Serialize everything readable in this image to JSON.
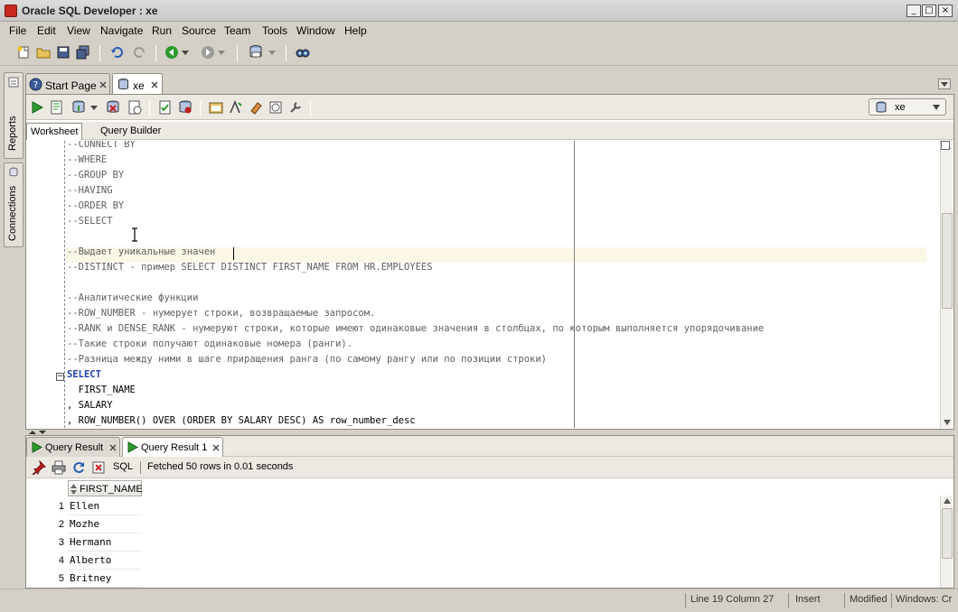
{
  "window": {
    "title": "Oracle SQL Developer : xe"
  },
  "menu": [
    "File",
    "Edit",
    "View",
    "Navigate",
    "Run",
    "Source",
    "Team",
    "Tools",
    "Window",
    "Help"
  ],
  "side_tabs": {
    "reports": "Reports",
    "connections": "Connections"
  },
  "doc_tabs": [
    {
      "label": "Start Page"
    },
    {
      "label": "xe"
    }
  ],
  "editor": {
    "connection": "xe",
    "subtabs": [
      "Worksheet",
      "Query Builder"
    ],
    "lines": [
      "--CONNECT BY",
      "--WHERE",
      "--GROUP BY",
      "--HAVING",
      "--ORDER BY",
      "--SELECT",
      "",
      "--Выдает уникальные значен",
      "--DISTINCT - пример SELECT DISTINCT FIRST_NAME FROM HR.EMPLOYEES",
      "",
      "--Аналитические функции",
      "--ROW_NUMBER - нумерует строки, возвращаемые запросом.",
      "--RANK и DENSE_RANK - нумеруют строки, которые имеют одинаковые значения в столбцах, по которым выполняется упорядочивание",
      "--Такие строки получают одинаковые номера (ранги).",
      "--Разница между ними в шаге приращения ранга (по самому рангу или по позиции строки)",
      "SELECT",
      "  FIRST_NAME",
      ", SALARY",
      ", ROW_NUMBER() OVER (ORDER BY SALARY DESC) AS row_number_desc"
    ]
  },
  "results": {
    "tabs": [
      {
        "label": "Query Result"
      },
      {
        "label": "Query Result 1"
      }
    ],
    "sql_label": "SQL",
    "fetch_status": "Fetched 50 rows in 0.01 seconds",
    "column": "FIRST_NAME",
    "rows": [
      {
        "n": "1",
        "v": "Ellen"
      },
      {
        "n": "2",
        "v": "Mozhe"
      },
      {
        "n": "3",
        "v": "Hermann"
      },
      {
        "n": "4",
        "v": "Alberto"
      },
      {
        "n": "5",
        "v": "Britney"
      }
    ]
  },
  "status": {
    "position": "Line 19 Column 27",
    "mode": "Insert",
    "state": "Modified",
    "platform": "Windows: Cr"
  },
  "colors": {
    "keyword": "#1f3fae",
    "comment": "#606060",
    "current_line": "#fbf6e6",
    "run_green": "#2e9a2e"
  }
}
